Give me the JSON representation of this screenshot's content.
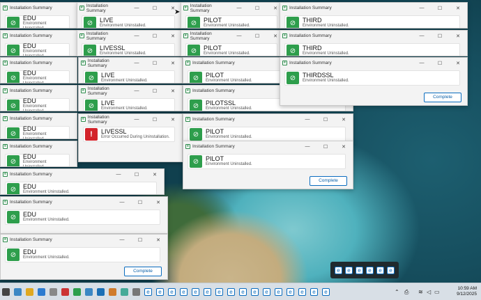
{
  "window_title": "Installation Summary",
  "minimize": "—",
  "maximize": "☐",
  "close": "✕",
  "complete_label": "Complete",
  "status_ok": "Environment Uninstalled.",
  "status_err": "Error Occurred During Uninstallation.",
  "windows": [
    {
      "env": "EDU"
    },
    {
      "env": "EDU"
    },
    {
      "env": "EDU"
    },
    {
      "env": "EDU"
    },
    {
      "env": "EDU"
    },
    {
      "env": "EDU"
    },
    {
      "env": "EDU"
    },
    {
      "env": "EDU"
    },
    {
      "env": "EDU"
    },
    {
      "env": "LIVE"
    },
    {
      "env": "LIVESSL"
    },
    {
      "env": "LIVE"
    },
    {
      "env": "LIVE"
    },
    {
      "env": "LIVESSL",
      "error": true
    },
    {
      "env": "PILOT"
    },
    {
      "env": "PILOT"
    },
    {
      "env": "PILOT"
    },
    {
      "env": "PILOTSSL"
    },
    {
      "env": "PILOT"
    },
    {
      "env": "PILOT"
    },
    {
      "env": "THIRD"
    },
    {
      "env": "THIRD"
    },
    {
      "env": "THIRDSSL"
    }
  ],
  "taskbar": {
    "time": "10:59 AM",
    "date": "9/12/2025"
  },
  "icons": {
    "ok": "check-shield-icon",
    "err": "exclamation-icon",
    "app": "e-app-icon"
  }
}
